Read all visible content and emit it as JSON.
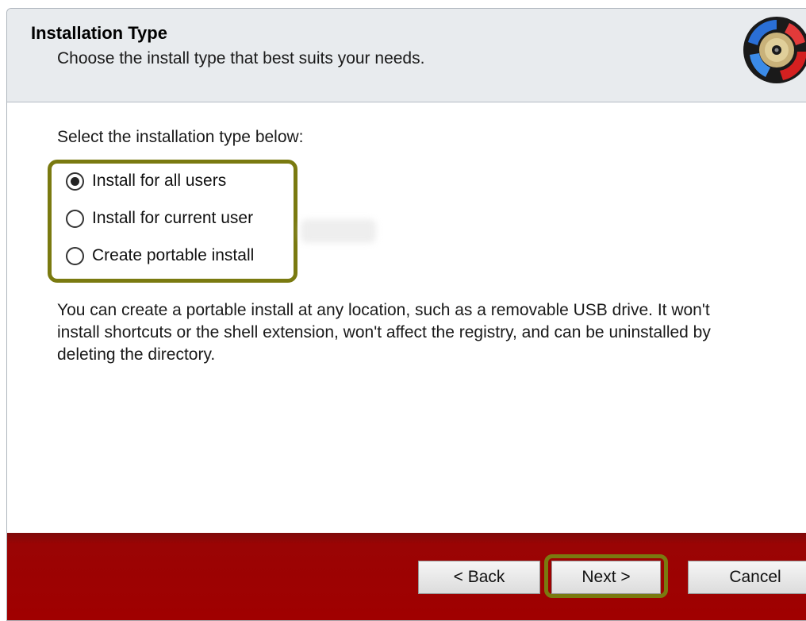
{
  "header": {
    "title": "Installation Type",
    "subtitle": "Choose the install type that best suits your needs."
  },
  "main": {
    "select_label": "Select the installation type below:",
    "options": [
      {
        "label": "Install for all users",
        "checked": true
      },
      {
        "label": "Install for current user",
        "checked": false
      },
      {
        "label": "Create portable install",
        "checked": false
      }
    ],
    "description": "You can create a portable install at any location, such as a removable USB drive.  It won't install shortcuts or the shell extension, won't affect the registry, and can be uninstalled by deleting the directory."
  },
  "footer": {
    "back_label": "< Back",
    "next_label": "Next >",
    "cancel_label": "Cancel"
  },
  "icons": {
    "logo": "app-logo-icon"
  },
  "colors": {
    "footer_red": "#a00000",
    "highlight_olive": "#7a7a10",
    "header_bg": "#e8ebee"
  }
}
